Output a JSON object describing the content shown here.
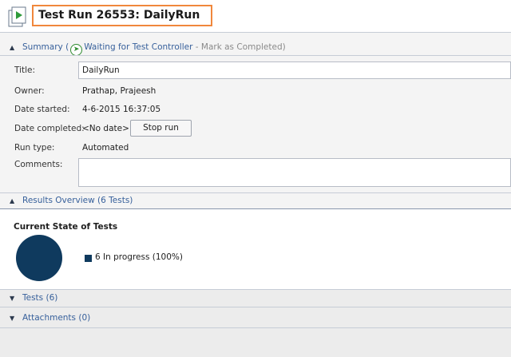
{
  "header": {
    "title": "Test Run 26553: DailyRun",
    "icon": "test-run-icon"
  },
  "summary": {
    "label": "Summary",
    "open_paren": "(",
    "status": "Waiting for Test Controller",
    "separator": "-",
    "mark_completed": "Mark as Completed",
    "close_paren": ")"
  },
  "fields": {
    "title_label": "Title:",
    "title_value": "DailyRun",
    "owner_label": "Owner:",
    "owner_value": "Prathap, Prajeesh",
    "date_started_label": "Date started:",
    "date_started_value": "4-6-2015 16:37:05",
    "date_completed_label": "Date completed:",
    "date_completed_value": "<No date>",
    "stop_run": "Stop run",
    "run_type_label": "Run type:",
    "run_type_value": "Automated",
    "comments_label": "Comments:",
    "comments_value": ""
  },
  "results": {
    "header": "Results Overview (6 Tests)",
    "chart_title": "Current State of Tests",
    "legend_label": "6 In progress (100%)"
  },
  "tests": {
    "header": "Tests (6)"
  },
  "attachments": {
    "header": "Attachments (0)"
  },
  "colors": {
    "accent": "#37609b",
    "highlight_box": "#f0873c",
    "pie": "#0f3a5e"
  },
  "chart_data": {
    "type": "pie",
    "title": "Current State of Tests",
    "slices": [
      {
        "label": "In progress",
        "count": 6,
        "percent": 100,
        "color": "#0f3a5e"
      }
    ]
  }
}
